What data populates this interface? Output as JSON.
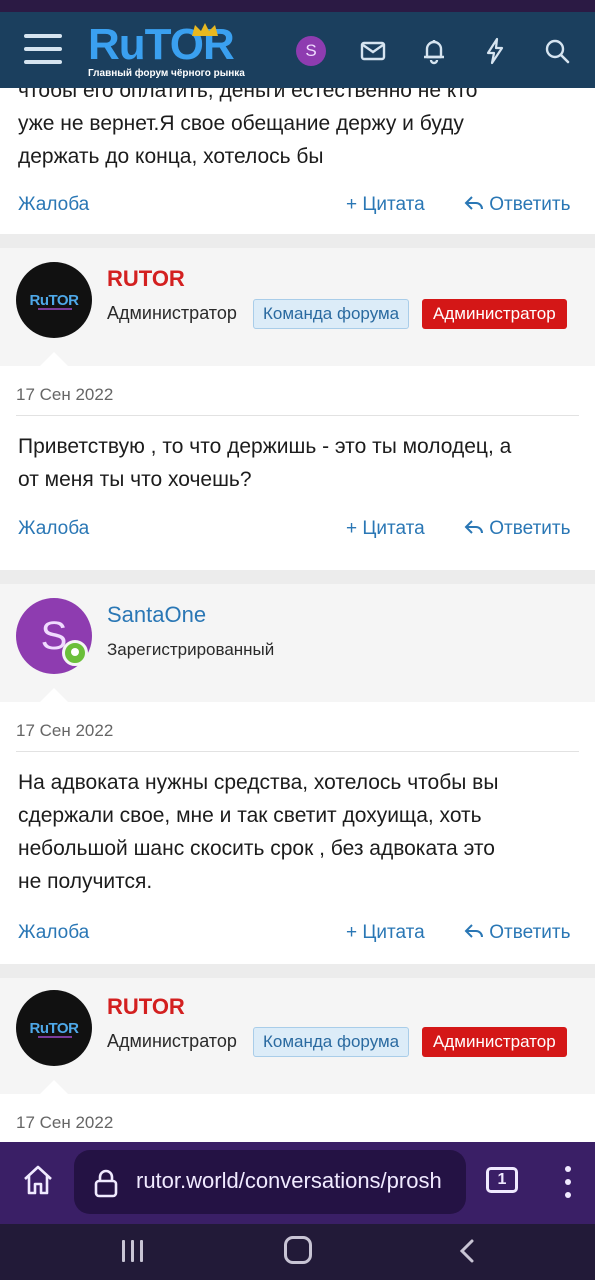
{
  "header": {
    "logo_text": "RuTOR",
    "logo_subtitle": "Главный форум чёрного рынка",
    "user_initial": "S"
  },
  "posts": [
    {
      "message_lines": [
        "чтобы его оплатить, деньги естественно не кто",
        "уже не вернет.Я свое обещание держу и буду",
        "держать до конца, хотелось бы"
      ],
      "actions": {
        "report": "Жалоба",
        "quote": "Цитата",
        "reply": "Ответить"
      }
    },
    {
      "author": "RUTOR",
      "avatar_text": "RuTOR",
      "role": "Администратор",
      "badges": [
        "Команда форума",
        "Администратор"
      ],
      "date": "17 Сен 2022",
      "message_lines": [
        "Приветствую , то что держишь - это ты молодец, а",
        "от меня ты что хочешь?"
      ],
      "actions": {
        "report": "Жалоба",
        "quote": "Цитата",
        "reply": "Ответить"
      }
    },
    {
      "author": "SantaOne",
      "avatar_text": "S",
      "role": "Зарегистрированный",
      "date": "17 Сен 2022",
      "message_lines": [
        "На адвоката нужны средства, хотелось чтобы вы",
        "сдержали свое, мне и так светит дохуища, хоть",
        "небольшой шанс скосить срок , без адвоката это",
        "не получится."
      ],
      "actions": {
        "report": "Жалоба",
        "quote": "Цитата",
        "reply": "Ответить"
      }
    },
    {
      "author": "RUTOR",
      "avatar_text": "RuTOR",
      "role": "Администратор",
      "badges": [
        "Команда форума",
        "Администратор"
      ],
      "date": "17 Сен 2022"
    }
  ],
  "browser": {
    "url": "rutor.world/conversations/prosh",
    "tab_count": "1"
  },
  "colors": {
    "header_bg": "#1b3f5e",
    "link": "#2a77b5",
    "admin_red": "#d41717",
    "browser_bar": "#3a1f66"
  }
}
